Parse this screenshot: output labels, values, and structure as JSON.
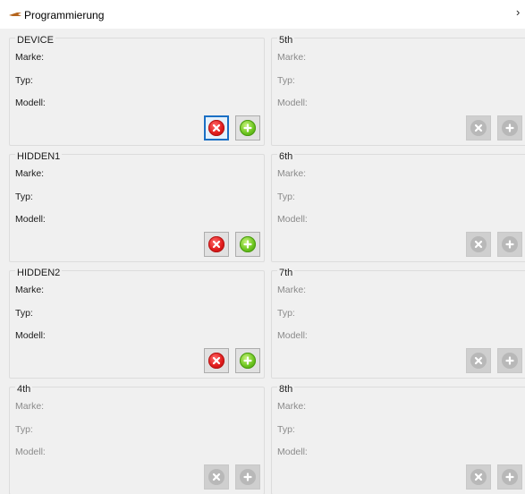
{
  "window": {
    "title": "Programmierung",
    "close_glyph": "›"
  },
  "colors": {
    "accent_focus": "#1a6fc4",
    "remove_red": "#e11b1b",
    "add_green": "#6cc51e",
    "disabled_grey": "#b8b8b8"
  },
  "labels": {
    "marke": "Marke:",
    "typ": "Typ:",
    "modell": "Modell:"
  },
  "groups": [
    {
      "title": "DEVICE",
      "enabled": true,
      "focused_button": "remove"
    },
    {
      "title": "HIDDEN1",
      "enabled": true,
      "focused_button": ""
    },
    {
      "title": "HIDDEN2",
      "enabled": true,
      "focused_button": ""
    },
    {
      "title": "4th",
      "enabled": false,
      "focused_button": ""
    },
    {
      "title": "5th",
      "enabled": false,
      "focused_button": ""
    },
    {
      "title": "6th",
      "enabled": false,
      "focused_button": ""
    },
    {
      "title": "7th",
      "enabled": false,
      "focused_button": ""
    },
    {
      "title": "8th",
      "enabled": false,
      "focused_button": ""
    }
  ],
  "icons": {
    "app": "arrow-logo-icon",
    "remove": "remove-circle-icon",
    "add": "add-circle-icon"
  }
}
